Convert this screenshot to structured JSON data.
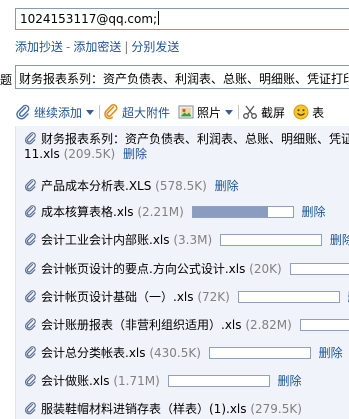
{
  "recipient": {
    "value": "1024153117@qq.com;"
  },
  "links": {
    "add_cc": "添加抄送",
    "add_bcc": "添加密送",
    "separate_send": "分别发送",
    "sep_dash": "-",
    "sep_bar": "|"
  },
  "subject": {
    "label": "题",
    "value": "财务报表系列：资产负债表、利润表、总账、明细账、凭证打印"
  },
  "toolbar": {
    "continue_add": "继续添加",
    "super_attach": "超大附件",
    "photo": "照片",
    "screenshot": "截屏",
    "emoticon": "表"
  },
  "attachments": [
    {
      "name_line1": "财务报表系列：资产负债表、利润表、总账、明细账、凭证",
      "name_line2": "11.xls",
      "size": "(209.5K)",
      "delete": "删除",
      "progress": null
    },
    {
      "name": "产品成本分析表.XLS",
      "size": "(578.5K)",
      "delete": "删除",
      "progress": null
    },
    {
      "name": "成本核算表格.xls",
      "size": "(2.21M)",
      "delete": "删除",
      "progress": 0.75
    },
    {
      "name": "会计工业会计内部账.xls",
      "size": "(3.3M)",
      "delete": "删除",
      "progress": 0.0
    },
    {
      "name": "会计帐页设计的要点.方向公式设计.xls",
      "size": "(20K)",
      "delete": "删除",
      "progress": 0.0
    },
    {
      "name": "会计帐页设计基础（一）.xls",
      "size": "(72K)",
      "delete": "删除",
      "progress": 0.0
    },
    {
      "name": "会计账册报表（非营利组织适用）.xls",
      "size": "(2.82M)",
      "delete": "删除",
      "progress": 0.0
    },
    {
      "name": "会计总分类帐表.xls",
      "size": "(430.5K)",
      "delete": "删除",
      "progress": 0.0
    },
    {
      "name": "会计做账.xls",
      "size": "(1.71M)",
      "delete": "删除",
      "progress": 0.0
    },
    {
      "name": "服装鞋帽材料进销存表（样表）(1).xls",
      "size": "(279.5K)",
      "delete": "",
      "progress": null
    }
  ]
}
